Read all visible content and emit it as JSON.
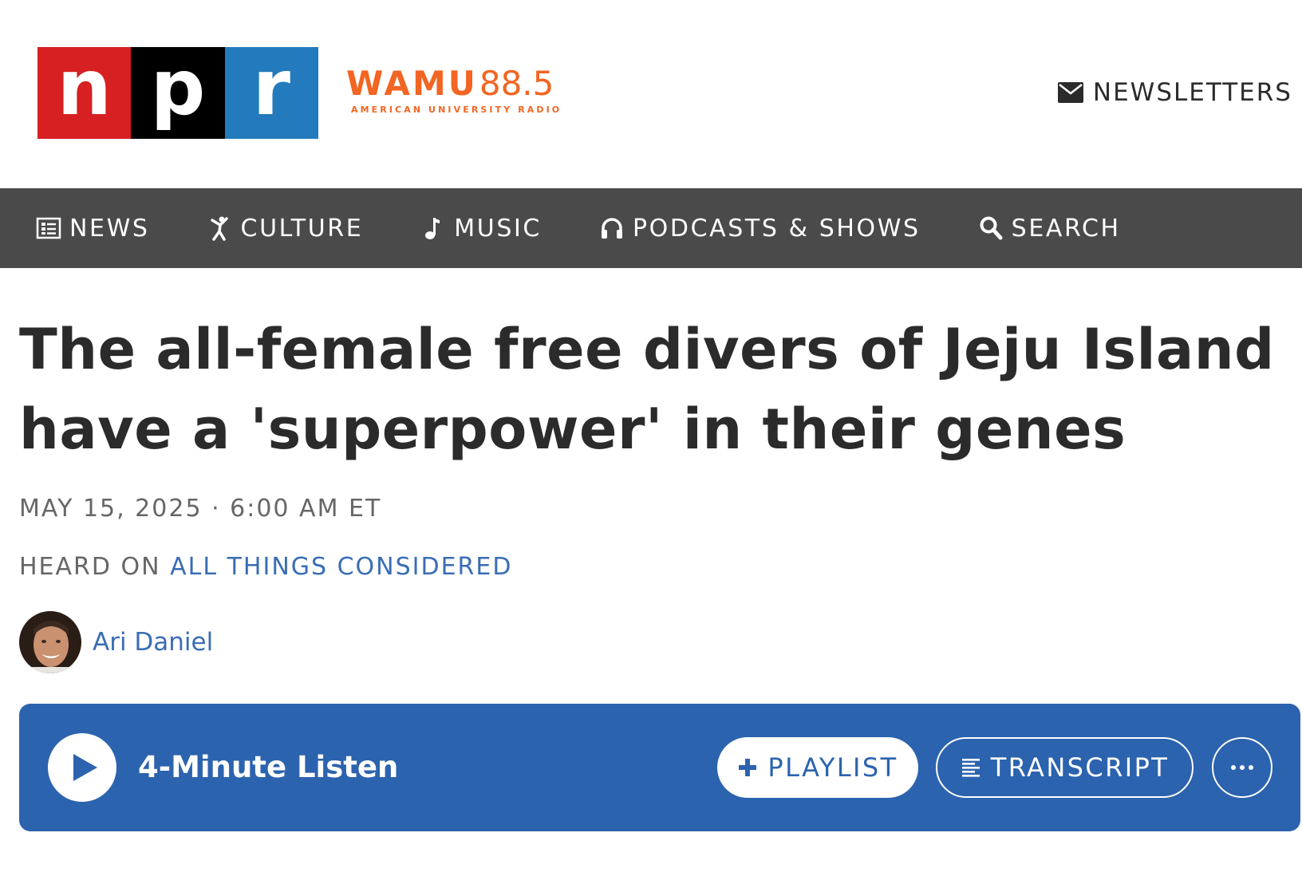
{
  "header": {
    "logo": {
      "letters": [
        "n",
        "p",
        "r"
      ],
      "colors": [
        "#d62021",
        "#000000",
        "#237bbd"
      ]
    },
    "station": {
      "name": "WAMU",
      "frequency": "88.5",
      "subtitle": "AMERICAN UNIVERSITY RADIO",
      "color": "#f26522"
    },
    "newsletters": {
      "icon": "mail-icon",
      "label": "NEWSLETTERS"
    }
  },
  "nav": {
    "items": [
      {
        "icon": "news-icon",
        "label": "NEWS"
      },
      {
        "icon": "culture-icon",
        "label": "CULTURE"
      },
      {
        "icon": "music-note-icon",
        "label": "MUSIC"
      },
      {
        "icon": "headphones-icon",
        "label": "PODCASTS & SHOWS"
      },
      {
        "icon": "search-icon",
        "label": "SEARCH"
      }
    ]
  },
  "article": {
    "headline": "The all-female free divers of Jeju Island have a 'superpower' in their genes",
    "dateline": "MAY 15, 2025 · 6:00 AM ET",
    "heard_on_prefix": "HEARD ON",
    "heard_on_show": "ALL THINGS CONSIDERED",
    "author": "Ari Daniel"
  },
  "player": {
    "listen_label": "4-Minute Listen",
    "playlist_label": "PLAYLIST",
    "transcript_label": "TRANSCRIPT",
    "accent": "#2c63ae"
  }
}
